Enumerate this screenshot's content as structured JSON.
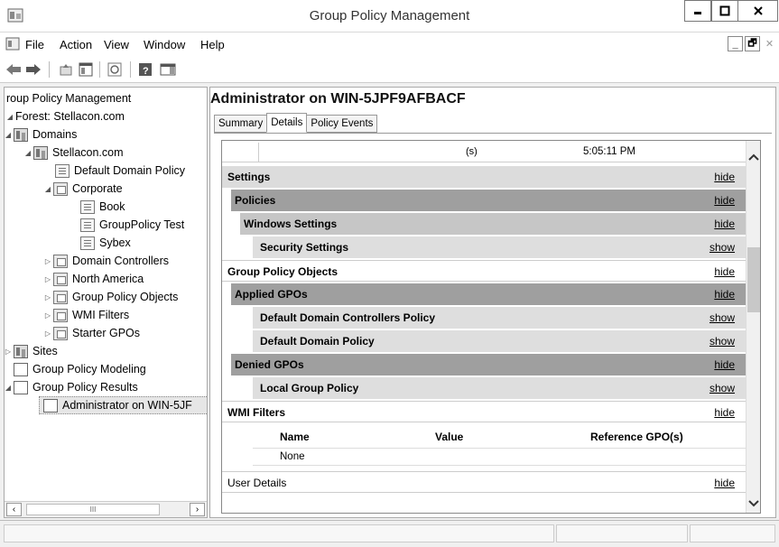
{
  "window": {
    "title": "Group Policy Management"
  },
  "menu": {
    "items": [
      "File",
      "Action",
      "View",
      "Window",
      "Help"
    ]
  },
  "tree": {
    "items": [
      {
        "label": "roup Policy Management"
      },
      {
        "label": "Forest: Stellacon.com"
      },
      {
        "label": "Domains"
      },
      {
        "label": "Stellacon.com"
      },
      {
        "label": "Default Domain Policy"
      },
      {
        "label": "Corporate"
      },
      {
        "label": "Book"
      },
      {
        "label": "GroupPolicy Test"
      },
      {
        "label": "Sybex"
      },
      {
        "label": "Domain Controllers"
      },
      {
        "label": "North America"
      },
      {
        "label": "Group Policy Objects"
      },
      {
        "label": "WMI Filters"
      },
      {
        "label": "Starter GPOs"
      },
      {
        "label": "Sites"
      },
      {
        "label": "Group Policy Modeling"
      },
      {
        "label": "Group Policy Results"
      },
      {
        "label": "Administrator on WIN-5JF"
      }
    ],
    "scroll_mid": "III"
  },
  "details": {
    "title": "Administrator on WIN-5JPF9AFBACF",
    "tabs": [
      "Summary",
      "Details",
      "Policy Events"
    ],
    "top_row": {
      "col1": "(s)",
      "col2": "5:05:11 PM"
    },
    "rows": [
      {
        "label": "Settings",
        "action": "hide"
      },
      {
        "label": "Policies",
        "action": "hide"
      },
      {
        "label": "Windows Settings",
        "action": "hide"
      },
      {
        "label": "Security Settings",
        "action": "show"
      },
      {
        "label": "Group Policy Objects",
        "action": "hide"
      },
      {
        "label": "Applied GPOs",
        "action": "hide"
      },
      {
        "label": "Default Domain Controllers Policy",
        "action": "show"
      },
      {
        "label": "Default Domain Policy",
        "action": "show"
      },
      {
        "label": "Denied GPOs",
        "action": "hide"
      },
      {
        "label": "Local Group Policy",
        "action": "show"
      },
      {
        "label": "WMI Filters",
        "action": "hide"
      }
    ],
    "wmi_table": {
      "headers": [
        "Name",
        "Value",
        "Reference GPO(s)"
      ],
      "rows": [
        [
          "None",
          "",
          ""
        ]
      ]
    },
    "user_details": {
      "label": "User Details",
      "action": "hide"
    }
  }
}
